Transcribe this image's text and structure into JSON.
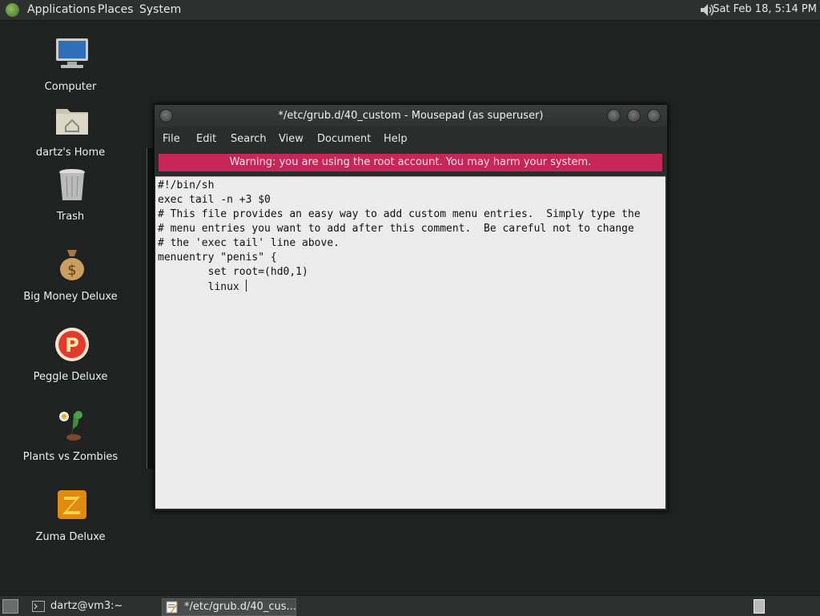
{
  "top_panel": {
    "menus": [
      "Applications",
      "Places",
      "System"
    ],
    "clock": "Sat Feb 18,  5:14 PM",
    "icons": {
      "apps": "gnome-foot-icon",
      "volume": "speaker-icon"
    }
  },
  "desktop": {
    "icons": [
      {
        "label": "Computer",
        "icon": "computer-icon"
      },
      {
        "label": "dartz's Home",
        "icon": "home-folder-icon"
      },
      {
        "label": "Trash",
        "icon": "trash-icon"
      },
      {
        "label": "Big Money Deluxe",
        "icon": "money-bag-icon"
      },
      {
        "label": "Peggle Deluxe",
        "icon": "peggle-icon"
      },
      {
        "label": "Plants vs Zombies",
        "icon": "flower-icon"
      },
      {
        "label": "Zuma Deluxe",
        "icon": "zuma-icon"
      }
    ]
  },
  "window": {
    "title": "*/etc/grub.d/40_custom - Mousepad (as superuser)",
    "menu": [
      "File",
      "Edit",
      "Search",
      "View",
      "Document",
      "Help"
    ],
    "warning": "Warning: you are using the root account. You may harm your system.",
    "content_lines": [
      "#!/bin/sh",
      "exec tail -n +3 $0",
      "# This file provides an easy way to add custom menu entries.  Simply type the",
      "# menu entries you want to add after this comment.  Be careful not to change",
      "# the 'exec tail' line above.",
      "menuentry \"penis\" {",
      "        set root=(hd0,1)",
      "        linux "
    ]
  },
  "taskbar": {
    "tasks": [
      {
        "label": "dartz@vm3:~",
        "icon": "terminal-icon"
      },
      {
        "label": "*/etc/grub.d/40_cus...",
        "icon": "text-editor-icon"
      }
    ]
  },
  "colors": {
    "warning_bg": "#c7265a",
    "panel_bg": "#2e3030",
    "desktop_bg": "#202121",
    "editor_bg": "#ececec"
  }
}
